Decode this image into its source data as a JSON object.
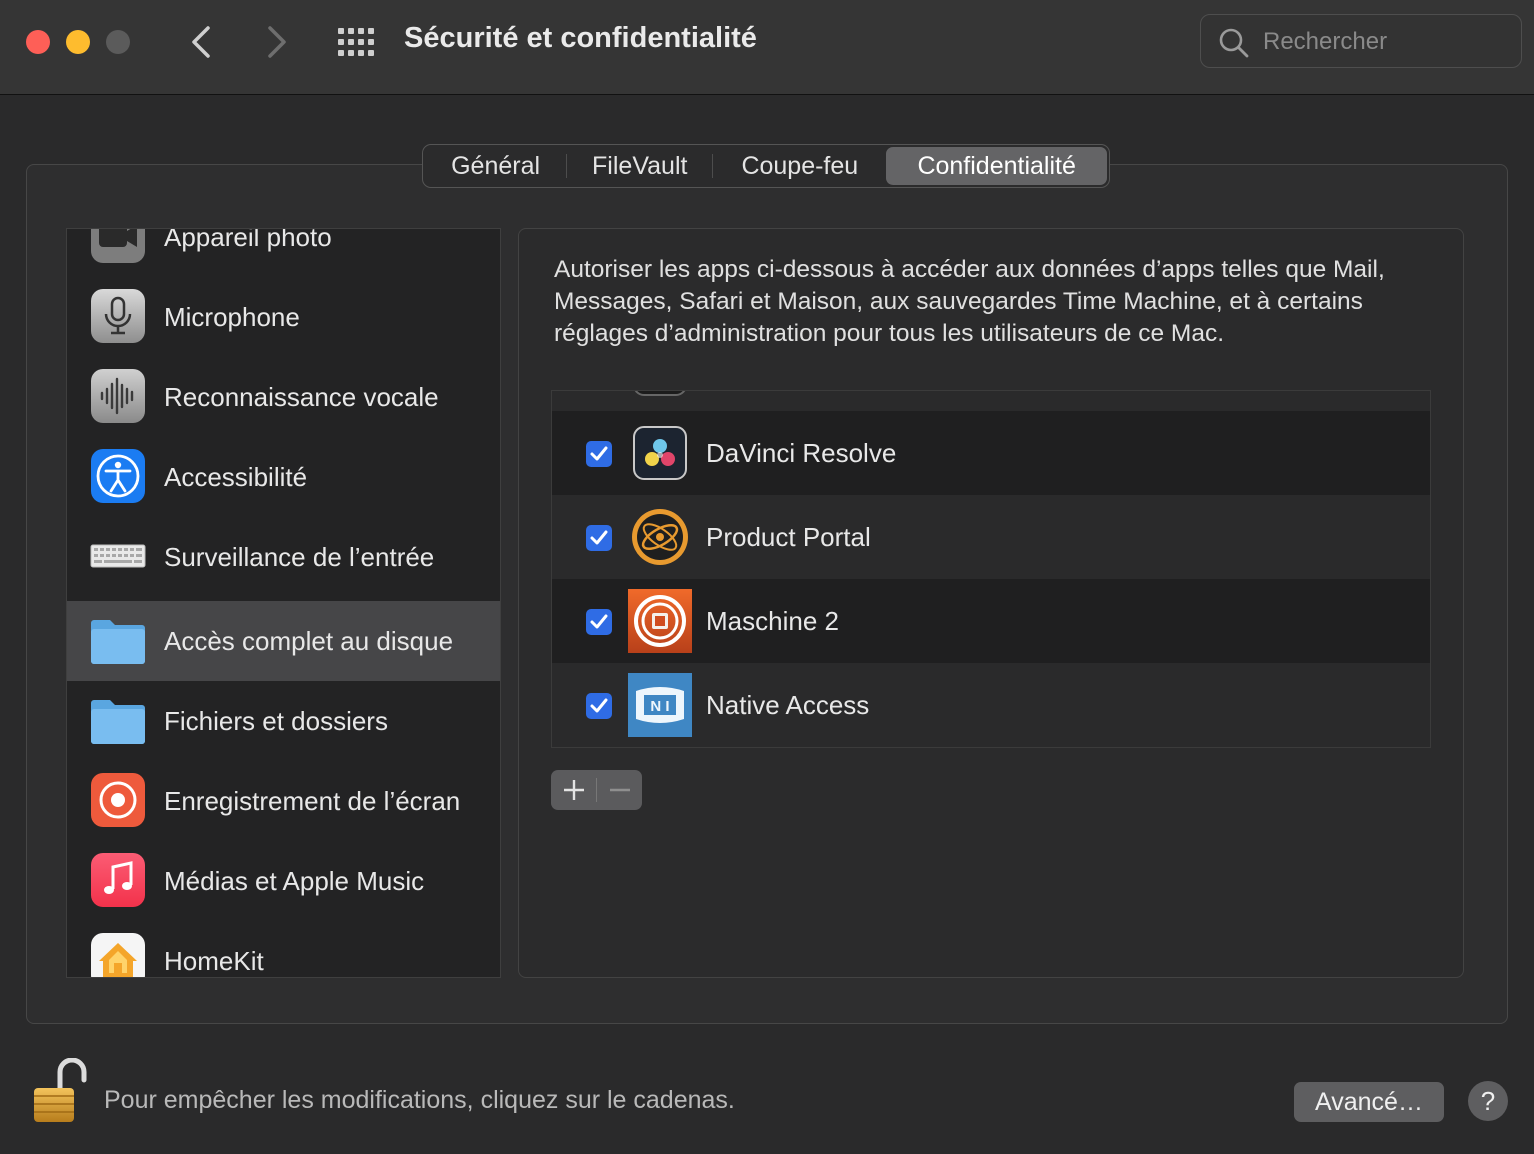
{
  "window": {
    "title": "Sécurité et confidentialité",
    "search_placeholder": "Rechercher"
  },
  "tabs": [
    {
      "label": "Général"
    },
    {
      "label": "FileVault"
    },
    {
      "label": "Coupe-feu"
    },
    {
      "label": "Confidentialité",
      "selected": true
    }
  ],
  "sidebar": {
    "items": [
      {
        "label": "Appareil photo",
        "icon": "camera-icon"
      },
      {
        "label": "Microphone",
        "icon": "microphone-icon"
      },
      {
        "label": "Reconnaissance vocale",
        "icon": "speech-waveform-icon"
      },
      {
        "label": "Accessibilité",
        "icon": "accessibility-icon"
      },
      {
        "label": "Surveillance de l’entrée",
        "icon": "keyboard-icon"
      },
      {
        "label": "Accès complet au disque",
        "icon": "folder-icon",
        "selected": true
      },
      {
        "label": "Fichiers et dossiers",
        "icon": "folder-icon"
      },
      {
        "label": "Enregistrement de l’écran",
        "icon": "screen-record-icon"
      },
      {
        "label": "Médias et Apple Music",
        "icon": "music-note-icon"
      },
      {
        "label": "HomeKit",
        "icon": "home-icon"
      }
    ]
  },
  "main": {
    "description": "Autoriser les apps ci-dessous à accéder aux données d’apps telles que Mail, Messages, Safari et Maison, aux sauvegardes Time Machine, et à certains réglages d’administration pour tous les utilisateurs de ce Mac.",
    "apps": [
      {
        "name": "DaVinci Resolve",
        "checked": true,
        "icon": "davinci-resolve-icon"
      },
      {
        "name": "Product Portal",
        "checked": true,
        "icon": "product-portal-icon"
      },
      {
        "name": "Maschine 2",
        "checked": true,
        "icon": "maschine-icon"
      },
      {
        "name": "Native Access",
        "checked": true,
        "icon": "native-access-icon"
      }
    ],
    "add_label": "+",
    "remove_label": "—"
  },
  "footer": {
    "lock_text": "Pour empêcher les modifications, cliquez sur le cadenas.",
    "advanced_label": "Avancé…",
    "help_label": "?"
  },
  "colors": {
    "accent": "#2f6ce5",
    "close": "#fe5f57",
    "minimize": "#febc2e"
  }
}
